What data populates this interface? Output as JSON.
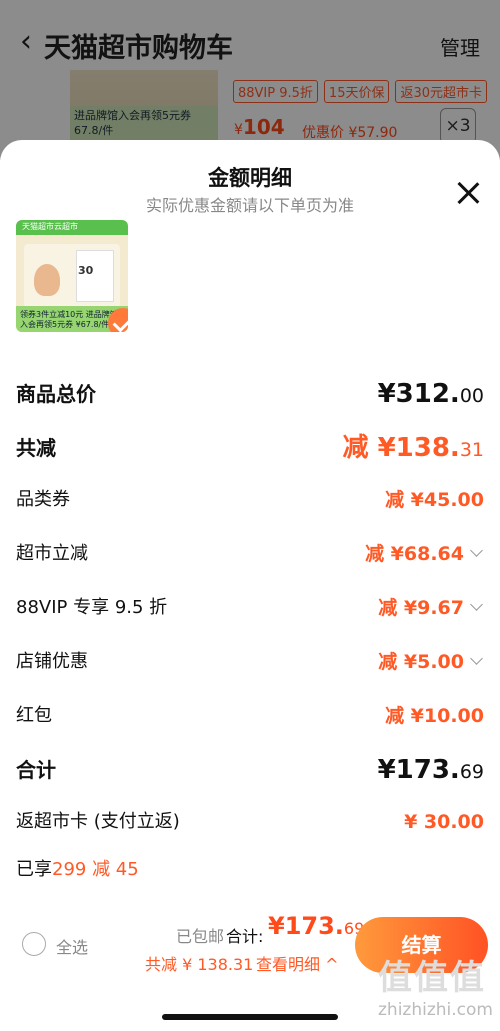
{
  "header": {
    "back_icon": "chevron-left-icon",
    "title": "天猫超市购物车",
    "manage": "管理"
  },
  "bg_product": {
    "promo_line": "进品牌馆入会再领5元券",
    "unit_price": "67.8/件",
    "tags": [
      "88VIP 9.5折",
      "15天价保",
      "返30元超市卡"
    ],
    "price_symbol": "¥",
    "price": "104",
    "discount_label": "优惠价",
    "discount_price": "¥57.90",
    "quantity": "×3"
  },
  "sheet": {
    "title": "金额明细",
    "subtitle": "实际优惠金额请以下单页为准",
    "product_img": {
      "top_text": "天猫超市云超市",
      "box_number": "30",
      "strip_text": "领券3件立减10元 进品牌馆入会再领5元券 ¥67.8/件"
    },
    "rows": {
      "total_price": {
        "label": "商品总价",
        "value_main": "¥312.",
        "value_dec": "00"
      },
      "total_reduce": {
        "label": "共减",
        "value_main": "减 ¥138.",
        "value_dec": "31"
      },
      "category_coupon": {
        "label": "品类券",
        "value": "减 ¥45.00"
      },
      "market_reduce": {
        "label": "超市立减",
        "value": "减 ¥68.64"
      },
      "vip_discount": {
        "label": "88VIP 专享 9.5 折",
        "value": "减 ¥9.67"
      },
      "shop_discount": {
        "label": "店铺优惠",
        "value": "减 ¥5.00"
      },
      "red_packet": {
        "label": "红包",
        "value": "减 ¥10.00"
      },
      "subtotal": {
        "label": "合计",
        "value_main": "¥173.",
        "value_dec": "69"
      },
      "return_card": {
        "label": "返超市卡 (支付立返)",
        "value": "¥ 30.00"
      }
    },
    "enjoy": {
      "prefix": "已享",
      "highlight": "299 减 45"
    }
  },
  "bottom_bar": {
    "select_all": "全选",
    "free_shipping": "已包邮",
    "total_label": "合计:",
    "total_main": "¥173.",
    "total_dec": "69",
    "reduce_text": "共减 ¥ 138.31",
    "view_detail": "查看明细 ^",
    "checkout": "结算"
  },
  "watermark": {
    "logo": "值值值",
    "url": "zhizhizhi.com"
  },
  "colors": {
    "accent": "#ff5a26",
    "checkout_start": "#ff9a3c",
    "checkout_end": "#ff5224"
  }
}
